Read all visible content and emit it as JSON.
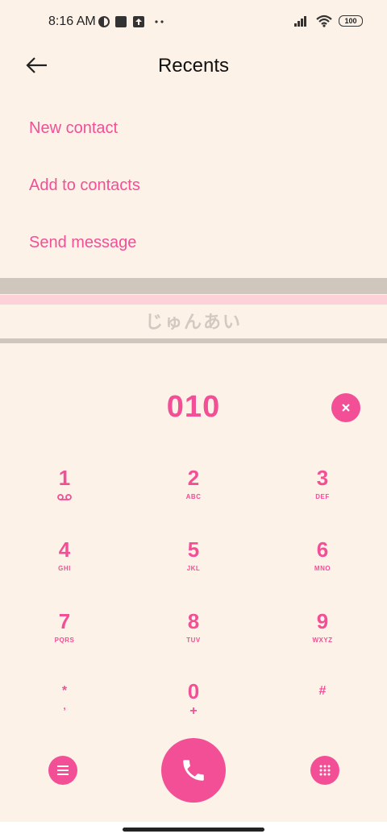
{
  "status_bar": {
    "time": "8:16 AM",
    "battery": "100"
  },
  "header": {
    "title": "Recents"
  },
  "actions": [
    {
      "label": "New contact"
    },
    {
      "label": "Add to contacts"
    },
    {
      "label": "Send message"
    }
  ],
  "watermark": "じゅんあい",
  "dialer": {
    "number": "010",
    "keys": [
      {
        "digit": "1",
        "letters": ""
      },
      {
        "digit": "2",
        "letters": "ABC"
      },
      {
        "digit": "3",
        "letters": "DEF"
      },
      {
        "digit": "4",
        "letters": "GHI"
      },
      {
        "digit": "5",
        "letters": "JKL"
      },
      {
        "digit": "6",
        "letters": "MNO"
      },
      {
        "digit": "7",
        "letters": "PQRS"
      },
      {
        "digit": "8",
        "letters": "TUV"
      },
      {
        "digit": "9",
        "letters": "WXYZ"
      },
      {
        "digit": "*",
        "letters": ","
      },
      {
        "digit": "0",
        "letters": "+"
      },
      {
        "digit": "#",
        "letters": ""
      }
    ]
  },
  "colors": {
    "accent": "#f24f96",
    "background": "#fdf2e8"
  },
  "icons": {
    "back": "back-arrow-icon",
    "clear": "close-icon",
    "voicemail": "voicemail-icon",
    "menu": "menu-icon",
    "call": "phone-icon",
    "keypad": "dialpad-icon"
  }
}
